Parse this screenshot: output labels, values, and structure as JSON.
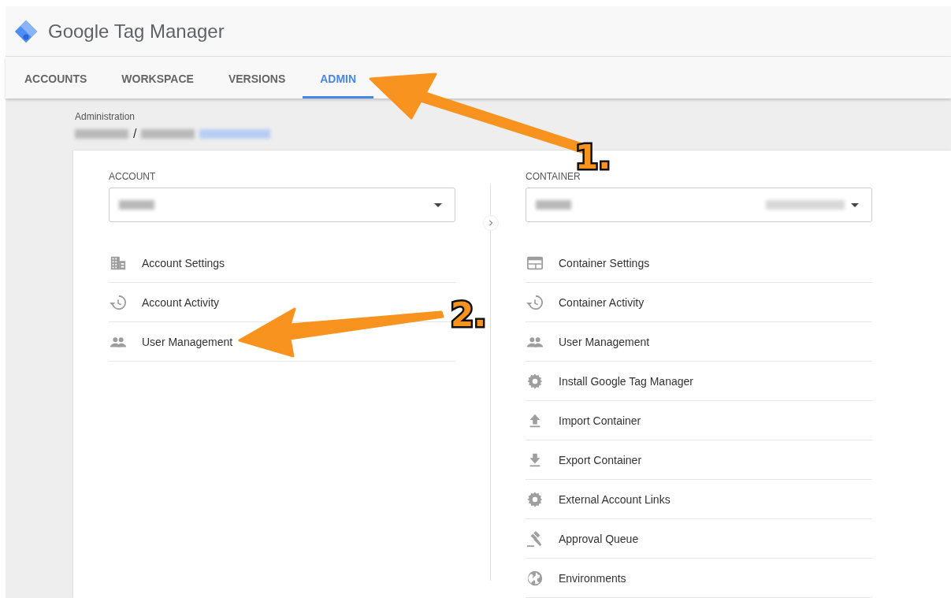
{
  "app": {
    "title": "Google Tag Manager"
  },
  "tabs": [
    {
      "label": "ACCOUNTS",
      "selected": false
    },
    {
      "label": "WORKSPACE",
      "selected": false
    },
    {
      "label": "VERSIONS",
      "selected": false
    },
    {
      "label": "ADMIN",
      "selected": true
    }
  ],
  "breadcrumb": {
    "title": "Administration",
    "separator": "/"
  },
  "account": {
    "heading": "ACCOUNT",
    "items": [
      {
        "label": "Account Settings"
      },
      {
        "label": "Account Activity"
      },
      {
        "label": "User Management"
      }
    ]
  },
  "container": {
    "heading": "CONTAINER",
    "items": [
      {
        "label": "Container Settings"
      },
      {
        "label": "Container Activity"
      },
      {
        "label": "User Management"
      },
      {
        "label": "Install Google Tag Manager"
      },
      {
        "label": "Import Container"
      },
      {
        "label": "Export Container"
      },
      {
        "label": "External Account Links"
      },
      {
        "label": "Approval Queue"
      },
      {
        "label": "Environments"
      }
    ]
  },
  "annotations": [
    {
      "label": "1."
    },
    {
      "label": "2."
    }
  ]
}
